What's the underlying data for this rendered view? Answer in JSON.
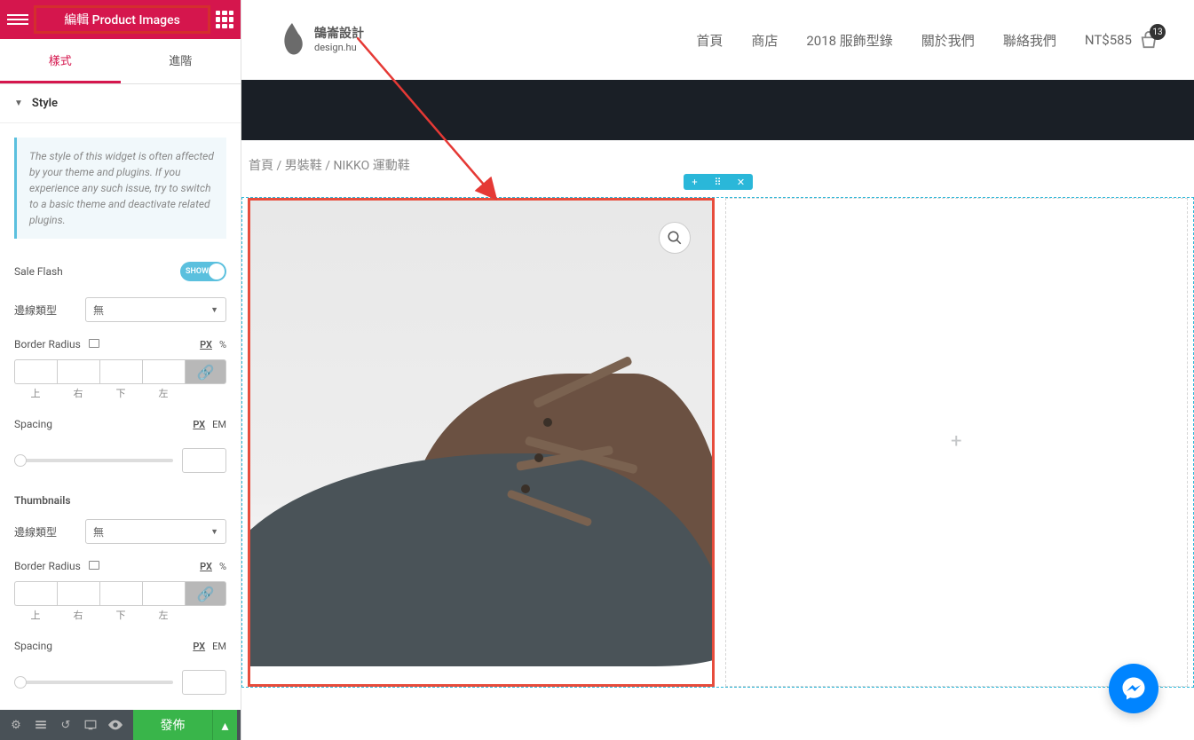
{
  "header": {
    "title": "編輯 Product Images"
  },
  "tabs": {
    "style": "樣式",
    "advanced": "進階"
  },
  "accordion": {
    "style": "Style"
  },
  "note": "The style of this widget is often affected by your theme and plugins. If you experience any such issue, try to switch to a basic theme and deactivate related plugins.",
  "controls": {
    "sale_flash": {
      "label": "Sale Flash",
      "value": "SHOW"
    },
    "border_type": {
      "label": "邊線類型",
      "value": "無"
    },
    "border_radius": {
      "label": "Border Radius"
    },
    "spacing": {
      "label": "Spacing"
    },
    "units": {
      "px": "PX",
      "pct": "%",
      "em": "EM"
    },
    "sides": {
      "top": "上",
      "right": "右",
      "bottom": "下",
      "left": "左"
    }
  },
  "thumbnails": {
    "heading": "Thumbnails"
  },
  "footer": {
    "publish": "發佈"
  },
  "site_nav": {
    "items": [
      "首頁",
      "商店",
      "2018 服飾型錄",
      "關於我們",
      "聯絡我們"
    ],
    "price": "NT$585",
    "cart_count": "13",
    "logo_main": "鵠崙設計",
    "logo_sub": "design.hu"
  },
  "breadcrumb": {
    "home": "首頁",
    "cat": "男裝鞋",
    "product": "NIKKO 運動鞋",
    "sep": " / "
  },
  "icons": {
    "chevron": "▼",
    "plus": "+",
    "edit": "✎",
    "zoom": "🔍",
    "close": "✕",
    "settings": "⚙",
    "layers": "≣",
    "history": "↺",
    "responsive": "▢",
    "preview": "👁",
    "drag": "⠿",
    "link": "🔗",
    "expand": "⛶",
    "caret_up": "▴"
  }
}
